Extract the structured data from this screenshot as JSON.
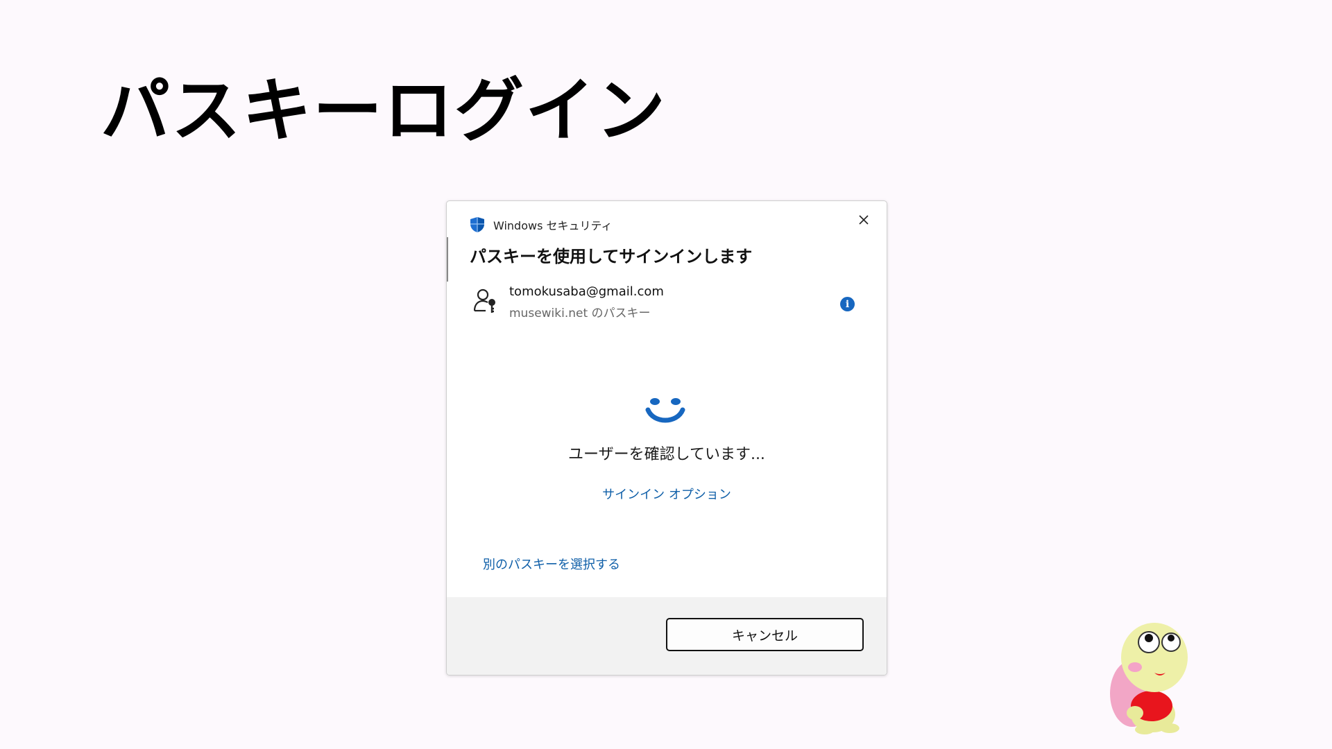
{
  "slide": {
    "title": "パスキーログイン"
  },
  "dialog": {
    "app_name": "Windows セキュリティ",
    "title": "パスキーを使用してサインインします",
    "account": {
      "email": "tomokusaba@gmail.com",
      "subtitle": "musewiki.net のパスキー"
    },
    "status_text": "ユーザーを確認しています...",
    "sign_in_options_link": "サインイン オプション",
    "choose_other_link": "別のパスキーを選択する",
    "cancel_label": "キャンセル"
  },
  "icons": {
    "app": "shield-icon",
    "close": "close-icon",
    "account": "key-user-icon",
    "info": "info-icon",
    "status": "windows-hello-smiley-icon",
    "mascot": "turtle-mascot-image"
  },
  "colors": {
    "accent": "#1767c0",
    "link": "#0f5fa8",
    "footer_bg": "#f2f2f2",
    "page_bg": "#fdf9fd"
  }
}
